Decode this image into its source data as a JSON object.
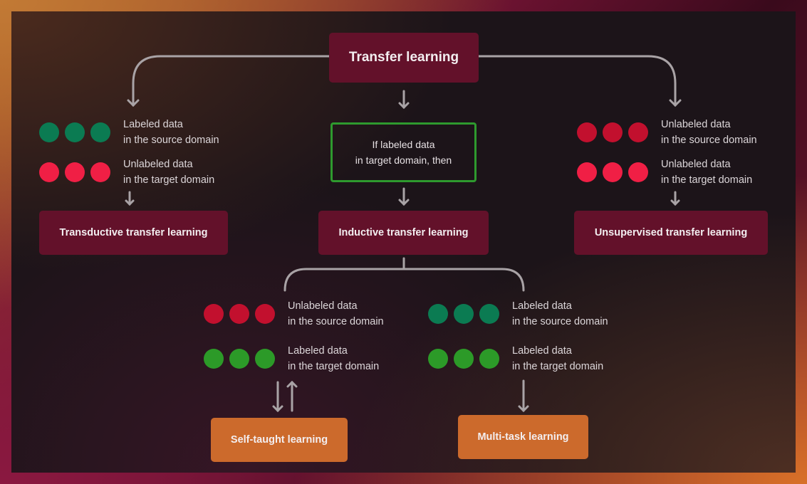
{
  "colors": {
    "labeled_source": "#0b7b52",
    "unlabeled_target": "#f01f45",
    "unlabeled_source": "#c2102e",
    "labeled_target": "#2c9a28",
    "maroon_box": "#63112a",
    "orange_box": "#cc6a2c",
    "condition_border": "#2e9a2e",
    "connector": "#a9a3a6"
  },
  "root": {
    "label": "Transfer learning"
  },
  "condition": {
    "line1": "If labeled data",
    "line2": "in target domain, then"
  },
  "branches": {
    "transductive": {
      "rows": [
        {
          "dot_color": "labeled_source",
          "line1": "Labeled data",
          "line2": "in the source domain"
        },
        {
          "dot_color": "unlabeled_target",
          "line1": "Unlabeled data",
          "line2": "in the target domain"
        }
      ],
      "result": "Transductive transfer learning"
    },
    "inductive": {
      "result": "Inductive transfer learning"
    },
    "unsupervised": {
      "rows": [
        {
          "dot_color": "unlabeled_source",
          "line1": "Unlabeled data",
          "line2": "in the source domain"
        },
        {
          "dot_color": "unlabeled_target",
          "line1": "Unlabeled data",
          "line2": "in the target domain"
        }
      ],
      "result": "Unsupervised transfer learning"
    }
  },
  "sub_branches": {
    "self_taught": {
      "rows": [
        {
          "dot_color": "unlabeled_source",
          "line1": "Unlabeled data",
          "line2": "in the source domain"
        },
        {
          "dot_color": "labeled_target",
          "line1": "Labeled data",
          "line2": "in the target domain"
        }
      ],
      "result": "Self-taught learning"
    },
    "multi_task": {
      "rows": [
        {
          "dot_color": "labeled_source",
          "line1": "Labeled data",
          "line2": "in the source domain"
        },
        {
          "dot_color": "labeled_target",
          "line1": "Labeled data",
          "line2": "in the target domain"
        }
      ],
      "result": "Multi-task learning"
    }
  }
}
